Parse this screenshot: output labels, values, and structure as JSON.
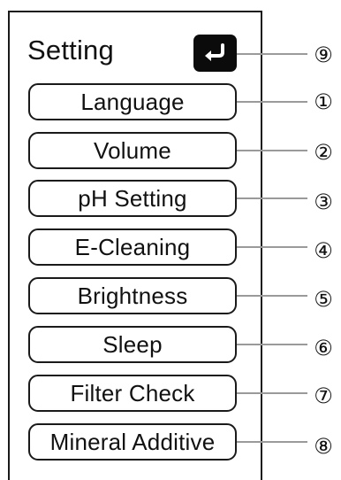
{
  "header": {
    "title": "Setting",
    "back_icon": "return-arrow-icon"
  },
  "menu": {
    "items": [
      {
        "label": "Language",
        "callout": "①"
      },
      {
        "label": "Volume",
        "callout": "②"
      },
      {
        "label": "pH Setting",
        "callout": "③"
      },
      {
        "label": "E-Cleaning",
        "callout": "④"
      },
      {
        "label": "Brightness",
        "callout": "⑤"
      },
      {
        "label": "Sleep",
        "callout": "⑥"
      },
      {
        "label": "Filter Check",
        "callout": "⑦"
      },
      {
        "label": "Mineral Additive",
        "callout": "⑧"
      }
    ]
  },
  "callouts": {
    "back": "⑨"
  },
  "colors": {
    "outline": "#1a1a1a",
    "leader_line": "#9a9a9a",
    "back_button_bg": "#0b0b0b",
    "back_icon": "#ffffff"
  }
}
